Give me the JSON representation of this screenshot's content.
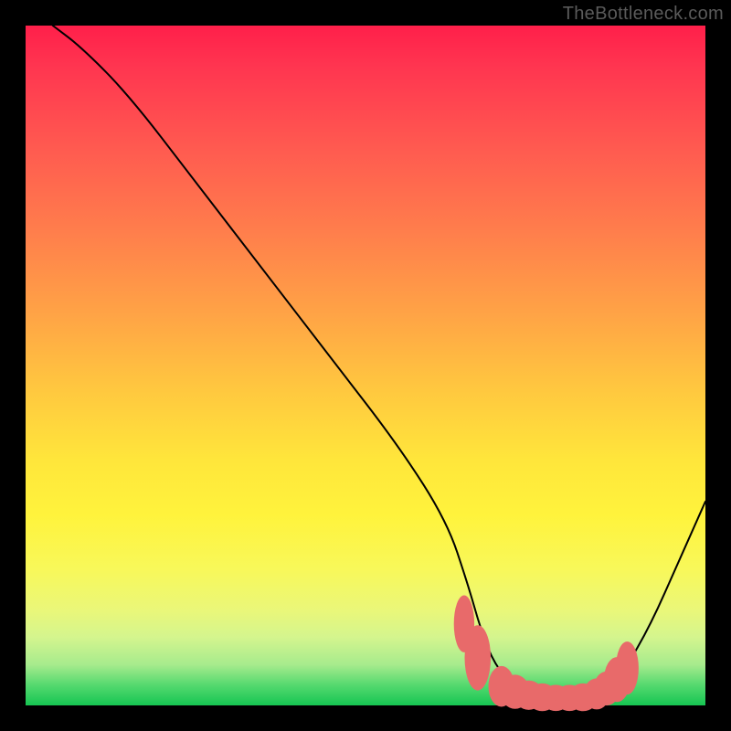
{
  "watermark": "TheBottleneck.com",
  "chart_data": {
    "type": "line",
    "title": "",
    "xlabel": "",
    "ylabel": "",
    "xlim": [
      0,
      100
    ],
    "ylim": [
      0,
      100
    ],
    "grid": false,
    "series": [
      {
        "name": "bottleneck-curve",
        "x": [
          4,
          8,
          15,
          25,
          35,
          45,
          55,
          62,
          65,
          67,
          69,
          72,
          75,
          78,
          81,
          84,
          86,
          88,
          92,
          96,
          100
        ],
        "y": [
          100,
          97,
          90,
          77,
          64,
          51,
          38,
          27,
          18,
          11,
          6,
          2.5,
          1.4,
          1.1,
          1.1,
          1.6,
          2.8,
          5,
          12,
          21,
          30
        ]
      }
    ],
    "markers": {
      "name": "highlight-points",
      "color": "#e86a6a",
      "x": [
        64.5,
        66.5,
        70,
        72,
        74,
        76,
        78,
        80,
        82,
        84,
        85.5,
        87,
        88.5
      ],
      "y": [
        12,
        7,
        2.8,
        2.0,
        1.5,
        1.2,
        1.1,
        1.1,
        1.2,
        1.7,
        2.5,
        3.8,
        5.5
      ],
      "rx": [
        2.5,
        3.2,
        3.2,
        3.6,
        3.6,
        3.6,
        3.6,
        3.6,
        3.6,
        3.2,
        3.2,
        3.2,
        2.8
      ],
      "ry": [
        7,
        8,
        5,
        4.2,
        3.6,
        3.4,
        3.2,
        3.2,
        3.4,
        3.8,
        4.2,
        5.5,
        6.5
      ]
    },
    "background_gradient": {
      "top": "#ff1f4a",
      "bottom": "#16c552"
    }
  }
}
